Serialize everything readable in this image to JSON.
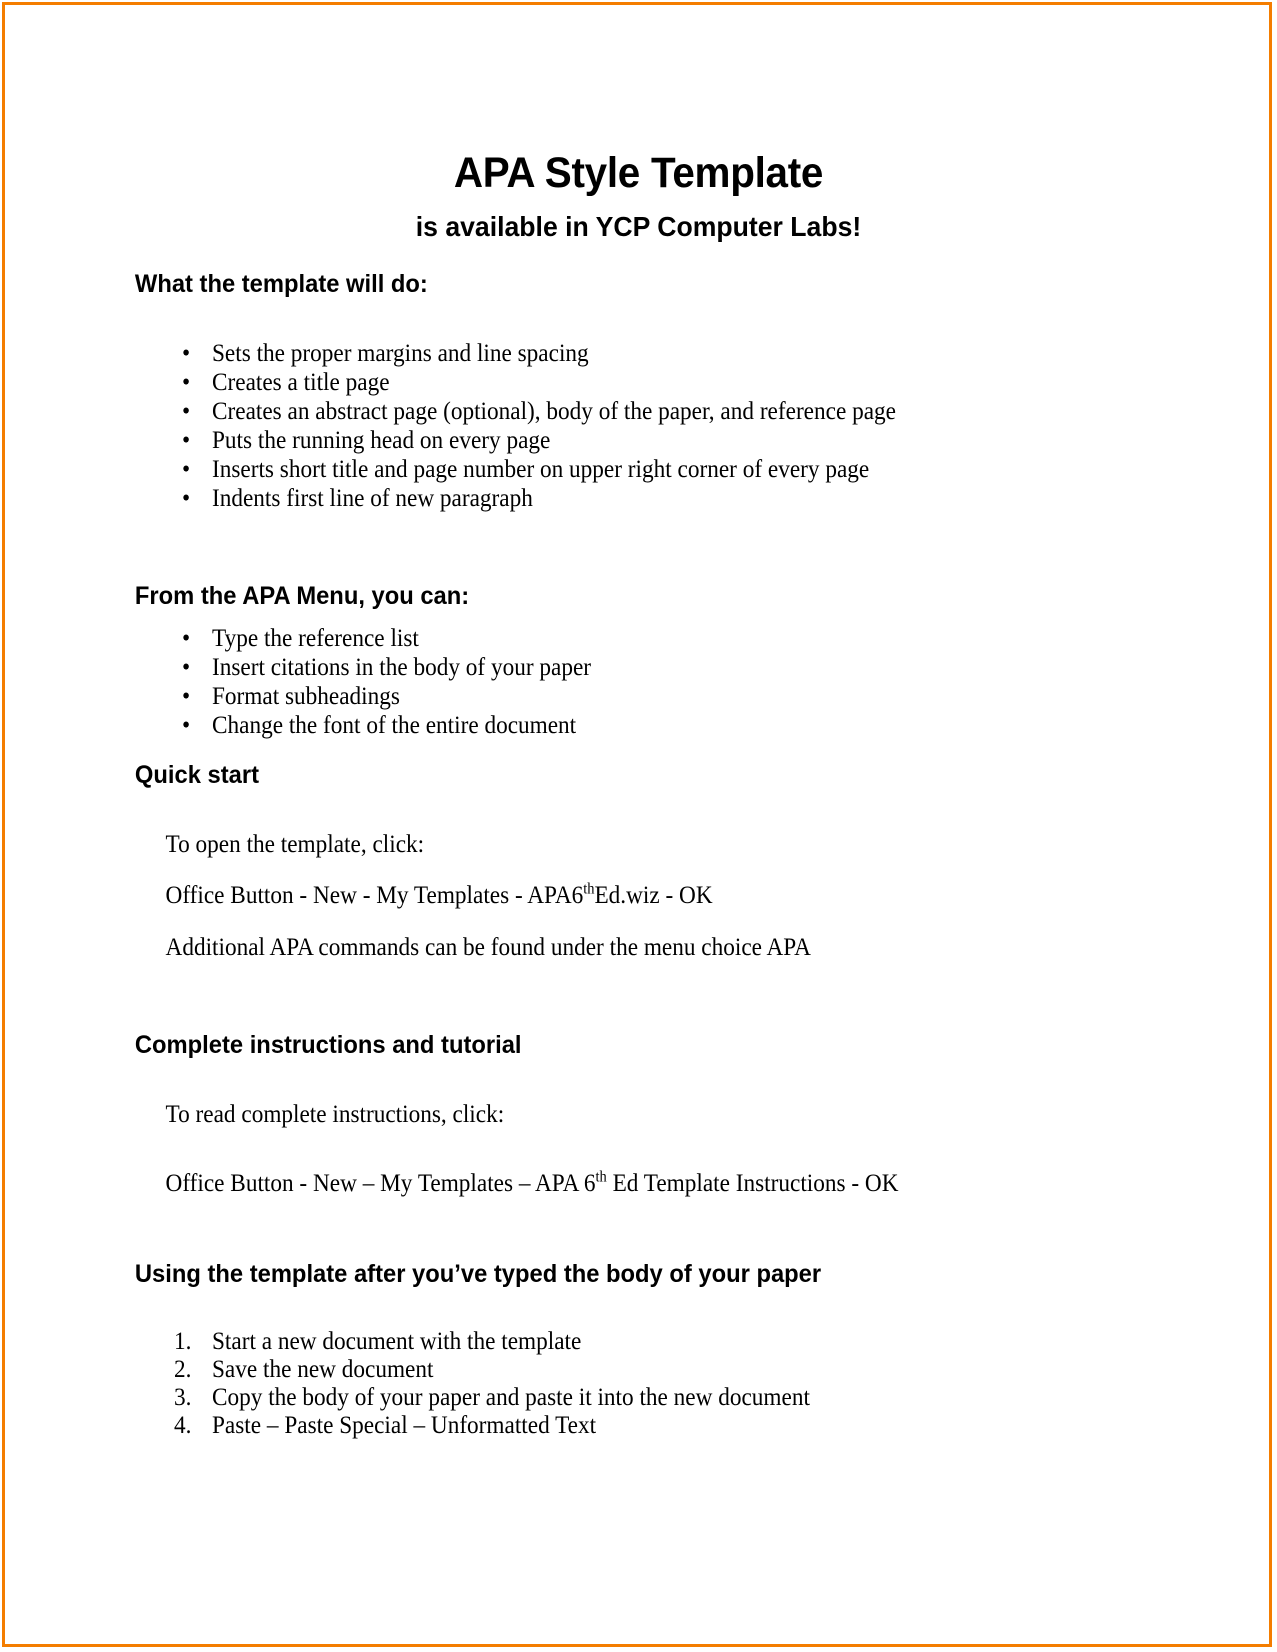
{
  "document": {
    "title_main": "APA Style Template",
    "title_sub": "is available in YCP Computer Labs!",
    "sections": [
      {
        "heading": "What the template will do:",
        "bullets": [
          "Sets the proper margins and line spacing",
          "Creates a title page",
          "Creates an abstract page (optional), body of the paper, and reference page",
          "Puts the running head on every page",
          "Inserts short title and page number on upper right corner of every page",
          "Indents first line of new paragraph"
        ]
      },
      {
        "heading": "From the APA Menu, you can:",
        "bullets": [
          "Type the reference list",
          "Insert citations in the body of your paper",
          "Format subheadings",
          "Change the font of the entire document"
        ]
      },
      {
        "heading": "Quick start",
        "paragraph_1": "To open the template, click:",
        "path_1_before": "Office Button  -    New   -   My Templates  -  APA6",
        "path_1_sup": "th",
        "path_1_after": "Ed.wiz -  OK",
        "paragraph_2": "Additional APA commands can be found under the menu choice APA"
      },
      {
        "heading": "Complete instructions and tutorial",
        "paragraph_1": "To read complete instructions, click:",
        "path_1_before": "Office Button  -  New – My Templates – APA 6",
        "path_1_sup": "th",
        "path_1_after": " Ed Template Instructions  -  OK"
      },
      {
        "heading": "Using the template after you’ve typed the body of your paper",
        "numbered": [
          "Start a new document with the template",
          "Save the new document",
          "Copy the body of your paper and paste it into the new document",
          "Paste – Paste Special – Unformatted Text"
        ],
        "markers": [
          "1.",
          "2.",
          "3.",
          "4."
        ]
      }
    ],
    "bullet_glyph": "•",
    "border_color": "#f47d00"
  }
}
